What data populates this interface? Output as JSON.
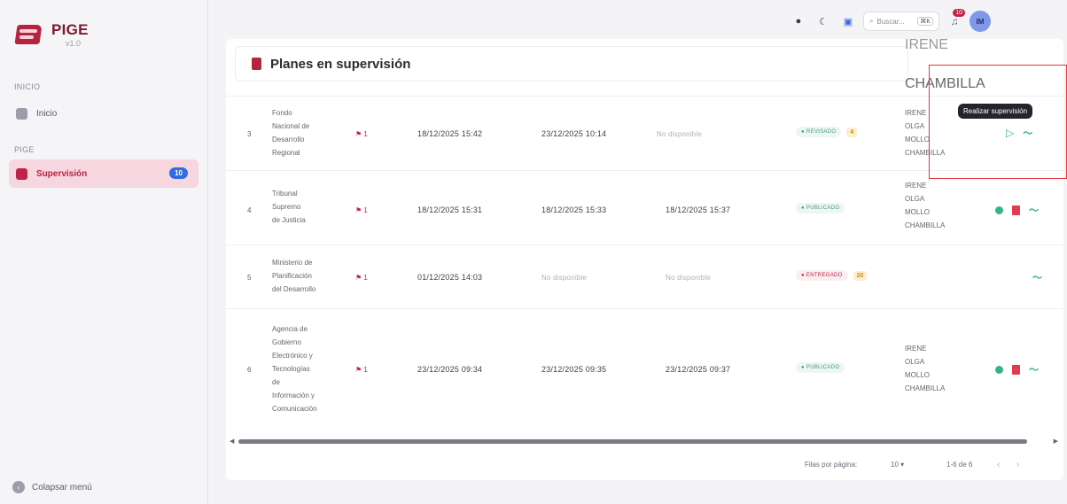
{
  "brand": {
    "name": "PIGE",
    "version": "v1.0"
  },
  "sidebar": {
    "section_inicio": "INICIO",
    "inicio_label": "Inicio",
    "section_pige": "PIGE",
    "supervision_label": "Supervisión",
    "supervision_badge": "10",
    "collapse_label": "Colapsar menú"
  },
  "topbar": {
    "search_placeholder": "Buscar...",
    "search_shortcut": "⌘K",
    "notifications_count": "10",
    "avatar_initials": "IM"
  },
  "card": {
    "title": "Planes en supervisión",
    "top_person_fragment": "IRENE",
    "top_person_last": "CHAMBILLA"
  },
  "rows": [
    {
      "num": "3",
      "entity": [
        "Fondo",
        "Nacional de",
        "Desarrollo",
        "Regional"
      ],
      "flag": "1",
      "date1": "18/12/2025 15:42",
      "date2": "23/12/2025 10:14",
      "date3": "No disponible",
      "status": "REVISADO",
      "count": "4",
      "person": [
        "IRENE",
        "OLGA",
        "MOLLO",
        "CHAMBILLA"
      ]
    },
    {
      "num": "4",
      "entity": [
        "Tribunal",
        "Supremo",
        "de Justicia"
      ],
      "flag": "1",
      "date1": "18/12/2025 15:31",
      "date2": "18/12/2025 15:33",
      "date3": "18/12/2025 15:37",
      "status": "PUBLICADO",
      "count": "",
      "person": [
        "IRENE",
        "OLGA",
        "MOLLO",
        "CHAMBILLA"
      ]
    },
    {
      "num": "5",
      "entity": [
        "Ministerio de",
        "Planificación",
        "del Desarrollo"
      ],
      "flag": "1",
      "date1": "01/12/2025 14:03",
      "date2": "No disponible",
      "date3": "No disponible",
      "status": "ENTREGADO",
      "count": "20",
      "person": []
    },
    {
      "num": "6",
      "entity": [
        "Agencia de",
        "Gobierno",
        "Electrónico y",
        "Tecnologías",
        "de",
        "Información y",
        "Comunicación"
      ],
      "flag": "1",
      "date1": "23/12/2025 09:34",
      "date2": "23/12/2025 09:35",
      "date3": "23/12/2025 09:37",
      "status": "PUBLICADO",
      "count": "",
      "person": [
        "IRENE",
        "OLGA",
        "MOLLO",
        "CHAMBILLA"
      ]
    }
  ],
  "footer": {
    "rows_per_page_label": "Filas por página:",
    "rows_per_page_value": "10",
    "range": "1-6 de 6"
  },
  "tooltip": "Realizar supervisión",
  "colors": {
    "brand": "#b5243f",
    "active_bg": "#f6d6df",
    "success": "#33b38a",
    "highlight": "#e5353a"
  },
  "icons": [
    "sun-icon",
    "moon-icon",
    "monitor-icon",
    "search-icon",
    "bell-icon",
    "clipboard-icon",
    "flag-icon",
    "eye-icon",
    "pdf-icon",
    "trend-icon",
    "play-icon"
  ]
}
